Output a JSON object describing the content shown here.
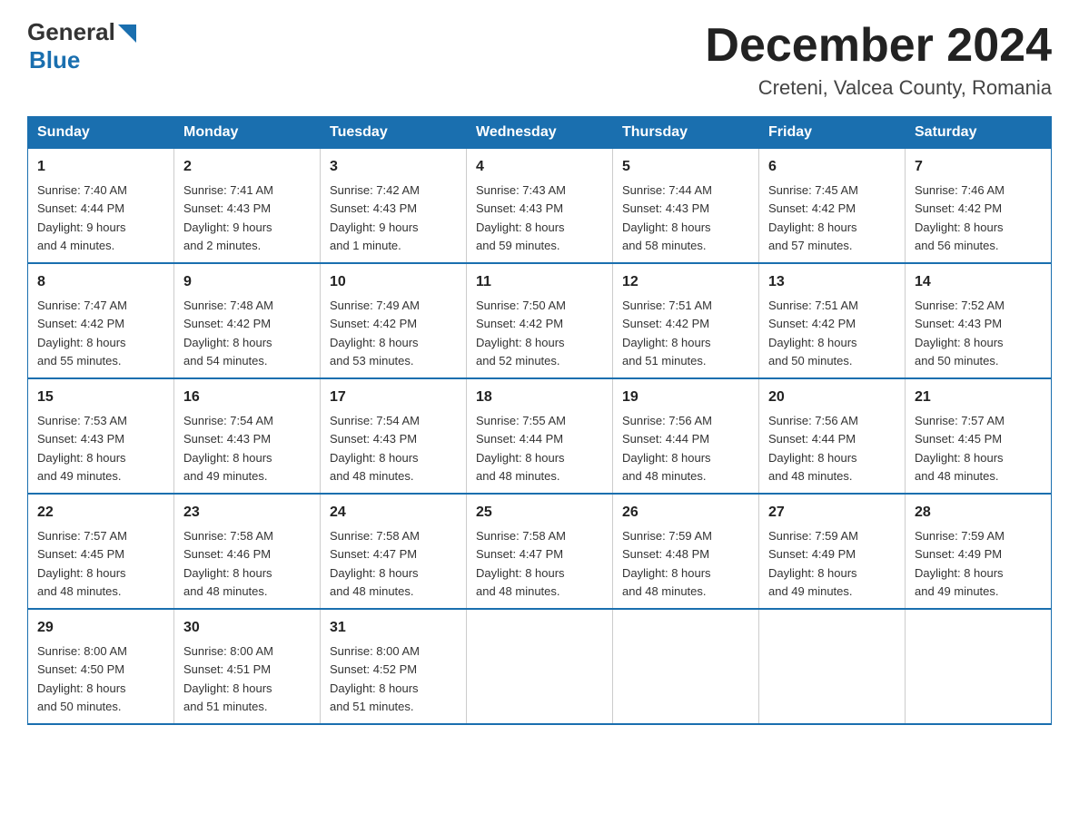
{
  "logo": {
    "general_text": "General",
    "blue_text": "Blue"
  },
  "header": {
    "month_year": "December 2024",
    "location": "Creteni, Valcea County, Romania"
  },
  "days_of_week": [
    "Sunday",
    "Monday",
    "Tuesday",
    "Wednesday",
    "Thursday",
    "Friday",
    "Saturday"
  ],
  "weeks": [
    [
      {
        "day": "1",
        "sunrise": "7:40 AM",
        "sunset": "4:44 PM",
        "daylight": "9 hours and 4 minutes."
      },
      {
        "day": "2",
        "sunrise": "7:41 AM",
        "sunset": "4:43 PM",
        "daylight": "9 hours and 2 minutes."
      },
      {
        "day": "3",
        "sunrise": "7:42 AM",
        "sunset": "4:43 PM",
        "daylight": "9 hours and 1 minute."
      },
      {
        "day": "4",
        "sunrise": "7:43 AM",
        "sunset": "4:43 PM",
        "daylight": "8 hours and 59 minutes."
      },
      {
        "day": "5",
        "sunrise": "7:44 AM",
        "sunset": "4:43 PM",
        "daylight": "8 hours and 58 minutes."
      },
      {
        "day": "6",
        "sunrise": "7:45 AM",
        "sunset": "4:42 PM",
        "daylight": "8 hours and 57 minutes."
      },
      {
        "day": "7",
        "sunrise": "7:46 AM",
        "sunset": "4:42 PM",
        "daylight": "8 hours and 56 minutes."
      }
    ],
    [
      {
        "day": "8",
        "sunrise": "7:47 AM",
        "sunset": "4:42 PM",
        "daylight": "8 hours and 55 minutes."
      },
      {
        "day": "9",
        "sunrise": "7:48 AM",
        "sunset": "4:42 PM",
        "daylight": "8 hours and 54 minutes."
      },
      {
        "day": "10",
        "sunrise": "7:49 AM",
        "sunset": "4:42 PM",
        "daylight": "8 hours and 53 minutes."
      },
      {
        "day": "11",
        "sunrise": "7:50 AM",
        "sunset": "4:42 PM",
        "daylight": "8 hours and 52 minutes."
      },
      {
        "day": "12",
        "sunrise": "7:51 AM",
        "sunset": "4:42 PM",
        "daylight": "8 hours and 51 minutes."
      },
      {
        "day": "13",
        "sunrise": "7:51 AM",
        "sunset": "4:42 PM",
        "daylight": "8 hours and 50 minutes."
      },
      {
        "day": "14",
        "sunrise": "7:52 AM",
        "sunset": "4:43 PM",
        "daylight": "8 hours and 50 minutes."
      }
    ],
    [
      {
        "day": "15",
        "sunrise": "7:53 AM",
        "sunset": "4:43 PM",
        "daylight": "8 hours and 49 minutes."
      },
      {
        "day": "16",
        "sunrise": "7:54 AM",
        "sunset": "4:43 PM",
        "daylight": "8 hours and 49 minutes."
      },
      {
        "day": "17",
        "sunrise": "7:54 AM",
        "sunset": "4:43 PM",
        "daylight": "8 hours and 48 minutes."
      },
      {
        "day": "18",
        "sunrise": "7:55 AM",
        "sunset": "4:44 PM",
        "daylight": "8 hours and 48 minutes."
      },
      {
        "day": "19",
        "sunrise": "7:56 AM",
        "sunset": "4:44 PM",
        "daylight": "8 hours and 48 minutes."
      },
      {
        "day": "20",
        "sunrise": "7:56 AM",
        "sunset": "4:44 PM",
        "daylight": "8 hours and 48 minutes."
      },
      {
        "day": "21",
        "sunrise": "7:57 AM",
        "sunset": "4:45 PM",
        "daylight": "8 hours and 48 minutes."
      }
    ],
    [
      {
        "day": "22",
        "sunrise": "7:57 AM",
        "sunset": "4:45 PM",
        "daylight": "8 hours and 48 minutes."
      },
      {
        "day": "23",
        "sunrise": "7:58 AM",
        "sunset": "4:46 PM",
        "daylight": "8 hours and 48 minutes."
      },
      {
        "day": "24",
        "sunrise": "7:58 AM",
        "sunset": "4:47 PM",
        "daylight": "8 hours and 48 minutes."
      },
      {
        "day": "25",
        "sunrise": "7:58 AM",
        "sunset": "4:47 PM",
        "daylight": "8 hours and 48 minutes."
      },
      {
        "day": "26",
        "sunrise": "7:59 AM",
        "sunset": "4:48 PM",
        "daylight": "8 hours and 48 minutes."
      },
      {
        "day": "27",
        "sunrise": "7:59 AM",
        "sunset": "4:49 PM",
        "daylight": "8 hours and 49 minutes."
      },
      {
        "day": "28",
        "sunrise": "7:59 AM",
        "sunset": "4:49 PM",
        "daylight": "8 hours and 49 minutes."
      }
    ],
    [
      {
        "day": "29",
        "sunrise": "8:00 AM",
        "sunset": "4:50 PM",
        "daylight": "8 hours and 50 minutes."
      },
      {
        "day": "30",
        "sunrise": "8:00 AM",
        "sunset": "4:51 PM",
        "daylight": "8 hours and 51 minutes."
      },
      {
        "day": "31",
        "sunrise": "8:00 AM",
        "sunset": "4:52 PM",
        "daylight": "8 hours and 51 minutes."
      },
      null,
      null,
      null,
      null
    ]
  ],
  "labels": {
    "sunrise": "Sunrise:",
    "sunset": "Sunset:",
    "daylight": "Daylight:"
  }
}
